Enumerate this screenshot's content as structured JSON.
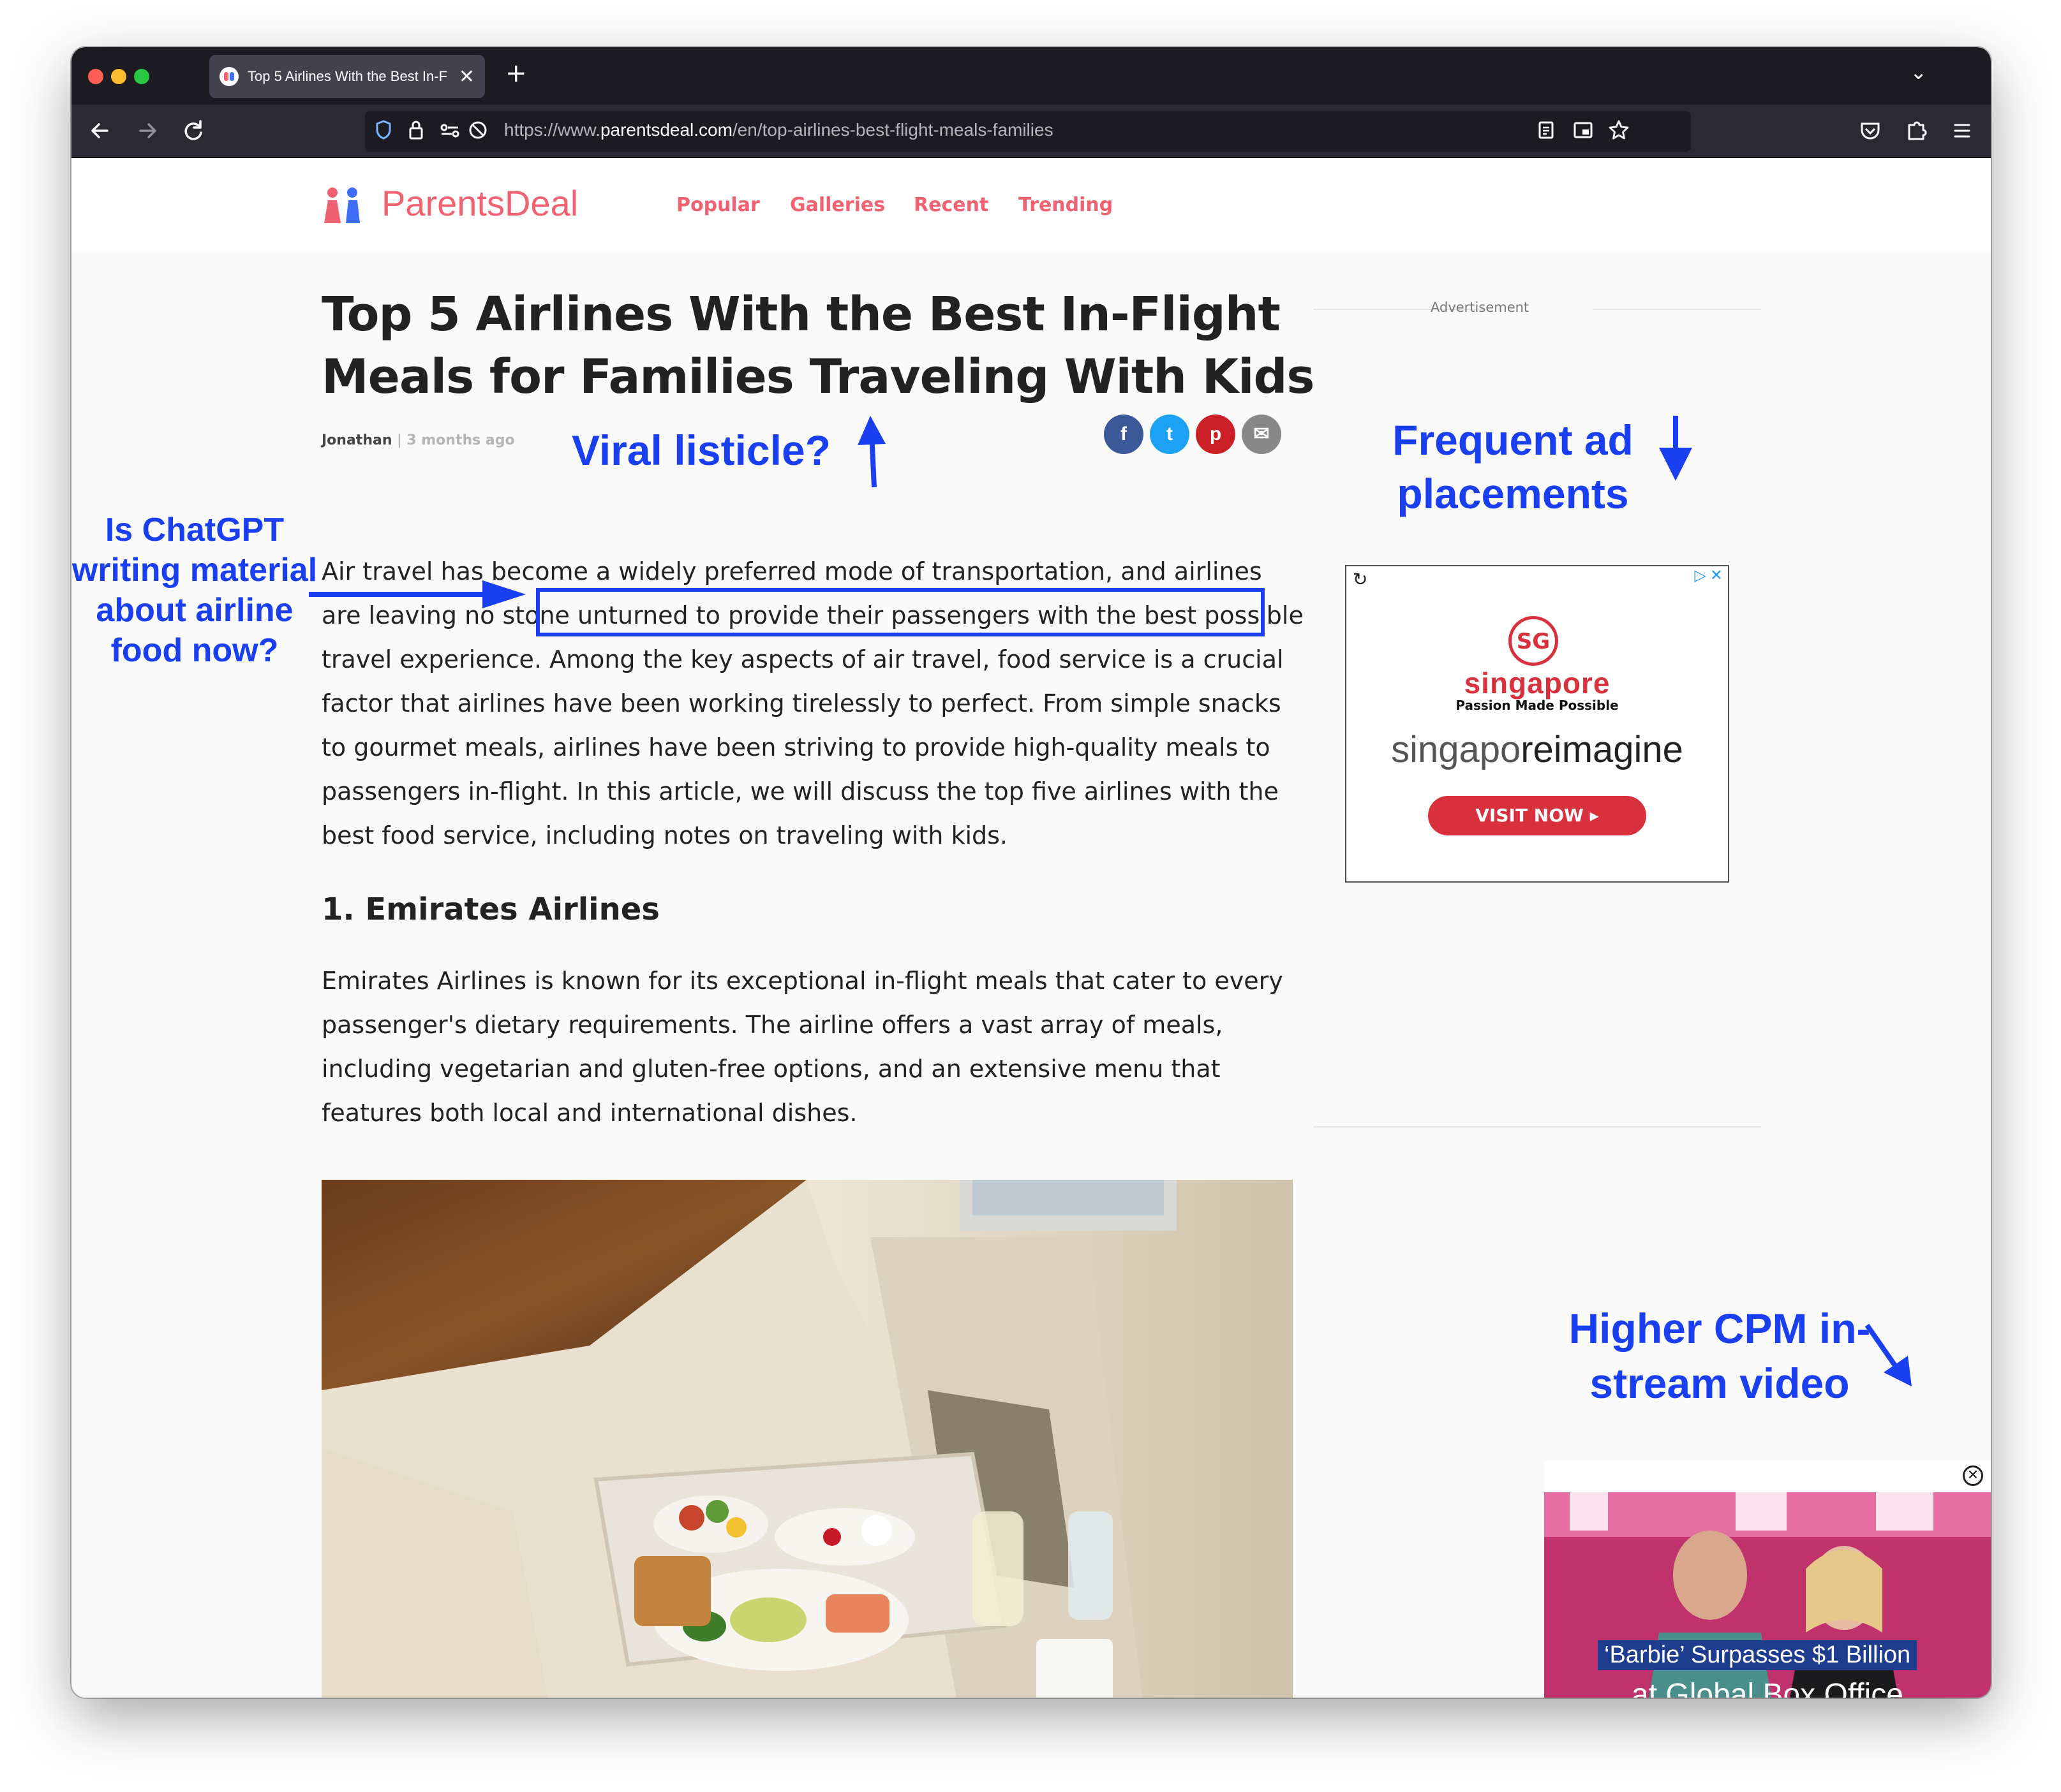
{
  "browser": {
    "tab_title": "Top 5 Airlines With the Best In-F",
    "tab_close": "✕",
    "new_tab": "+",
    "list_tabs": "⌄",
    "url_scheme": "https://www.",
    "url_host": "parentsdeal.com",
    "url_path": "/en/top-airlines-best-flight-meals-families"
  },
  "site": {
    "logo_text": "ParentsDeal",
    "brand_color": "#f06272",
    "nav": [
      "Popular",
      "Galleries",
      "Recent",
      "Trending"
    ]
  },
  "article": {
    "title": "Top 5 Airlines With the Best In-Flight Meals for Families Traveling With Kids",
    "author": "Jonathan",
    "separator": "|",
    "time_ago": "3 months ago",
    "intro": "Air travel has become a widely preferred mode of transportation, and airlines are leaving no stone unturned to provide their passengers with the best possible travel experience. Among the key aspects of air travel, food service is a crucial factor that airlines have been working tirelessly to perfect. From simple snacks to gourmet meals, airlines have been striving to provide high-quality meals to passengers in-flight. In this article, we will discuss the top five airlines with the best food service, including notes on traveling with kids.",
    "section_heading": "1. Emirates Airlines",
    "section_body": "Emirates Airlines is known for its exceptional in-flight meals that cater to every passenger's dietary requirements. The airline offers a vast array of meals, including vegetarian and gluten-free options, and an extensive menu that features both local and international dishes."
  },
  "share": {
    "facebook": "f",
    "twitter": "t",
    "pinterest": "p",
    "email": "✉",
    "colors": {
      "facebook": "#3b5998",
      "twitter": "#1da1f2",
      "pinterest": "#cb2027",
      "email": "#888888"
    }
  },
  "ad": {
    "label": "Advertisement",
    "logo_mark": "SG",
    "logo_word": "singapore",
    "tagline": "Passion Made Possible",
    "headline_a": "singapo",
    "headline_b": "reimagine",
    "cta": "VISIT NOW ▸",
    "adchoices": "▷",
    "close": "✕",
    "replay": "↻",
    "accent_color": "#d9303e"
  },
  "video": {
    "caption_line1": "‘Barbie’ Surpasses $1 Billion",
    "caption_line2": "at Global Box Office",
    "close": "✕"
  },
  "annotations": {
    "viral": "Viral listicle?",
    "chatgpt": "Is ChatGPT writing material about airline food now?",
    "ads": "Frequent ad placements",
    "video": "Higher CPM in-stream video",
    "color": "#1a3ff0"
  }
}
